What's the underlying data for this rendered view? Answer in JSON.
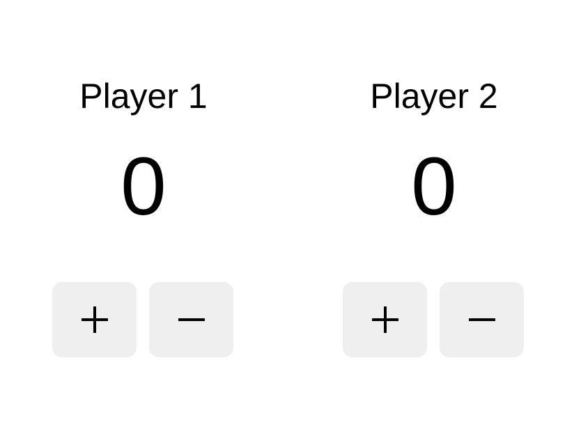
{
  "players": [
    {
      "name": "Player 1",
      "score": "0",
      "increment_label": "+",
      "decrement_label": "−"
    },
    {
      "name": "Player 2",
      "score": "0",
      "increment_label": "+",
      "decrement_label": "−"
    }
  ],
  "colors": {
    "background": "#ffffff",
    "text": "#000000",
    "button_background": "#efefef"
  },
  "icons": {
    "increment": "plus-icon",
    "decrement": "minus-icon"
  }
}
